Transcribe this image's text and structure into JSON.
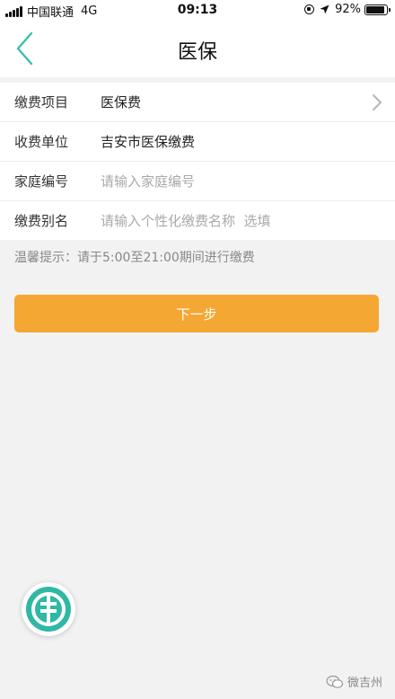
{
  "status_bar": {
    "carrier": "中国联通",
    "network": "4G",
    "time": "09:13",
    "battery": "92%",
    "battery_level": 0.92
  },
  "header": {
    "title": "医保"
  },
  "form": {
    "rows": [
      {
        "label": "缴费项目",
        "value": "医保费"
      },
      {
        "label": "收费单位",
        "value": "吉安市医保缴费"
      },
      {
        "label": "家庭编号",
        "placeholder": "请输入家庭编号"
      },
      {
        "label": "缴费别名",
        "placeholder": "请输入个性化缴费名称  选填"
      }
    ]
  },
  "hint": "温馨提示：请于5:00至21:00期间进行缴费",
  "next_button": "下一步",
  "colors": {
    "accent_teal": "#3bbfae",
    "button_orange": "#f5a733",
    "background": "#f2f2f2"
  },
  "watermark": {
    "text": "微吉州"
  },
  "icons": {
    "back": "chevron-left-icon",
    "row_arrow": "chevron-right-icon",
    "bank_logo": "bank-logo-icon",
    "watermark": "wechat-icon"
  }
}
